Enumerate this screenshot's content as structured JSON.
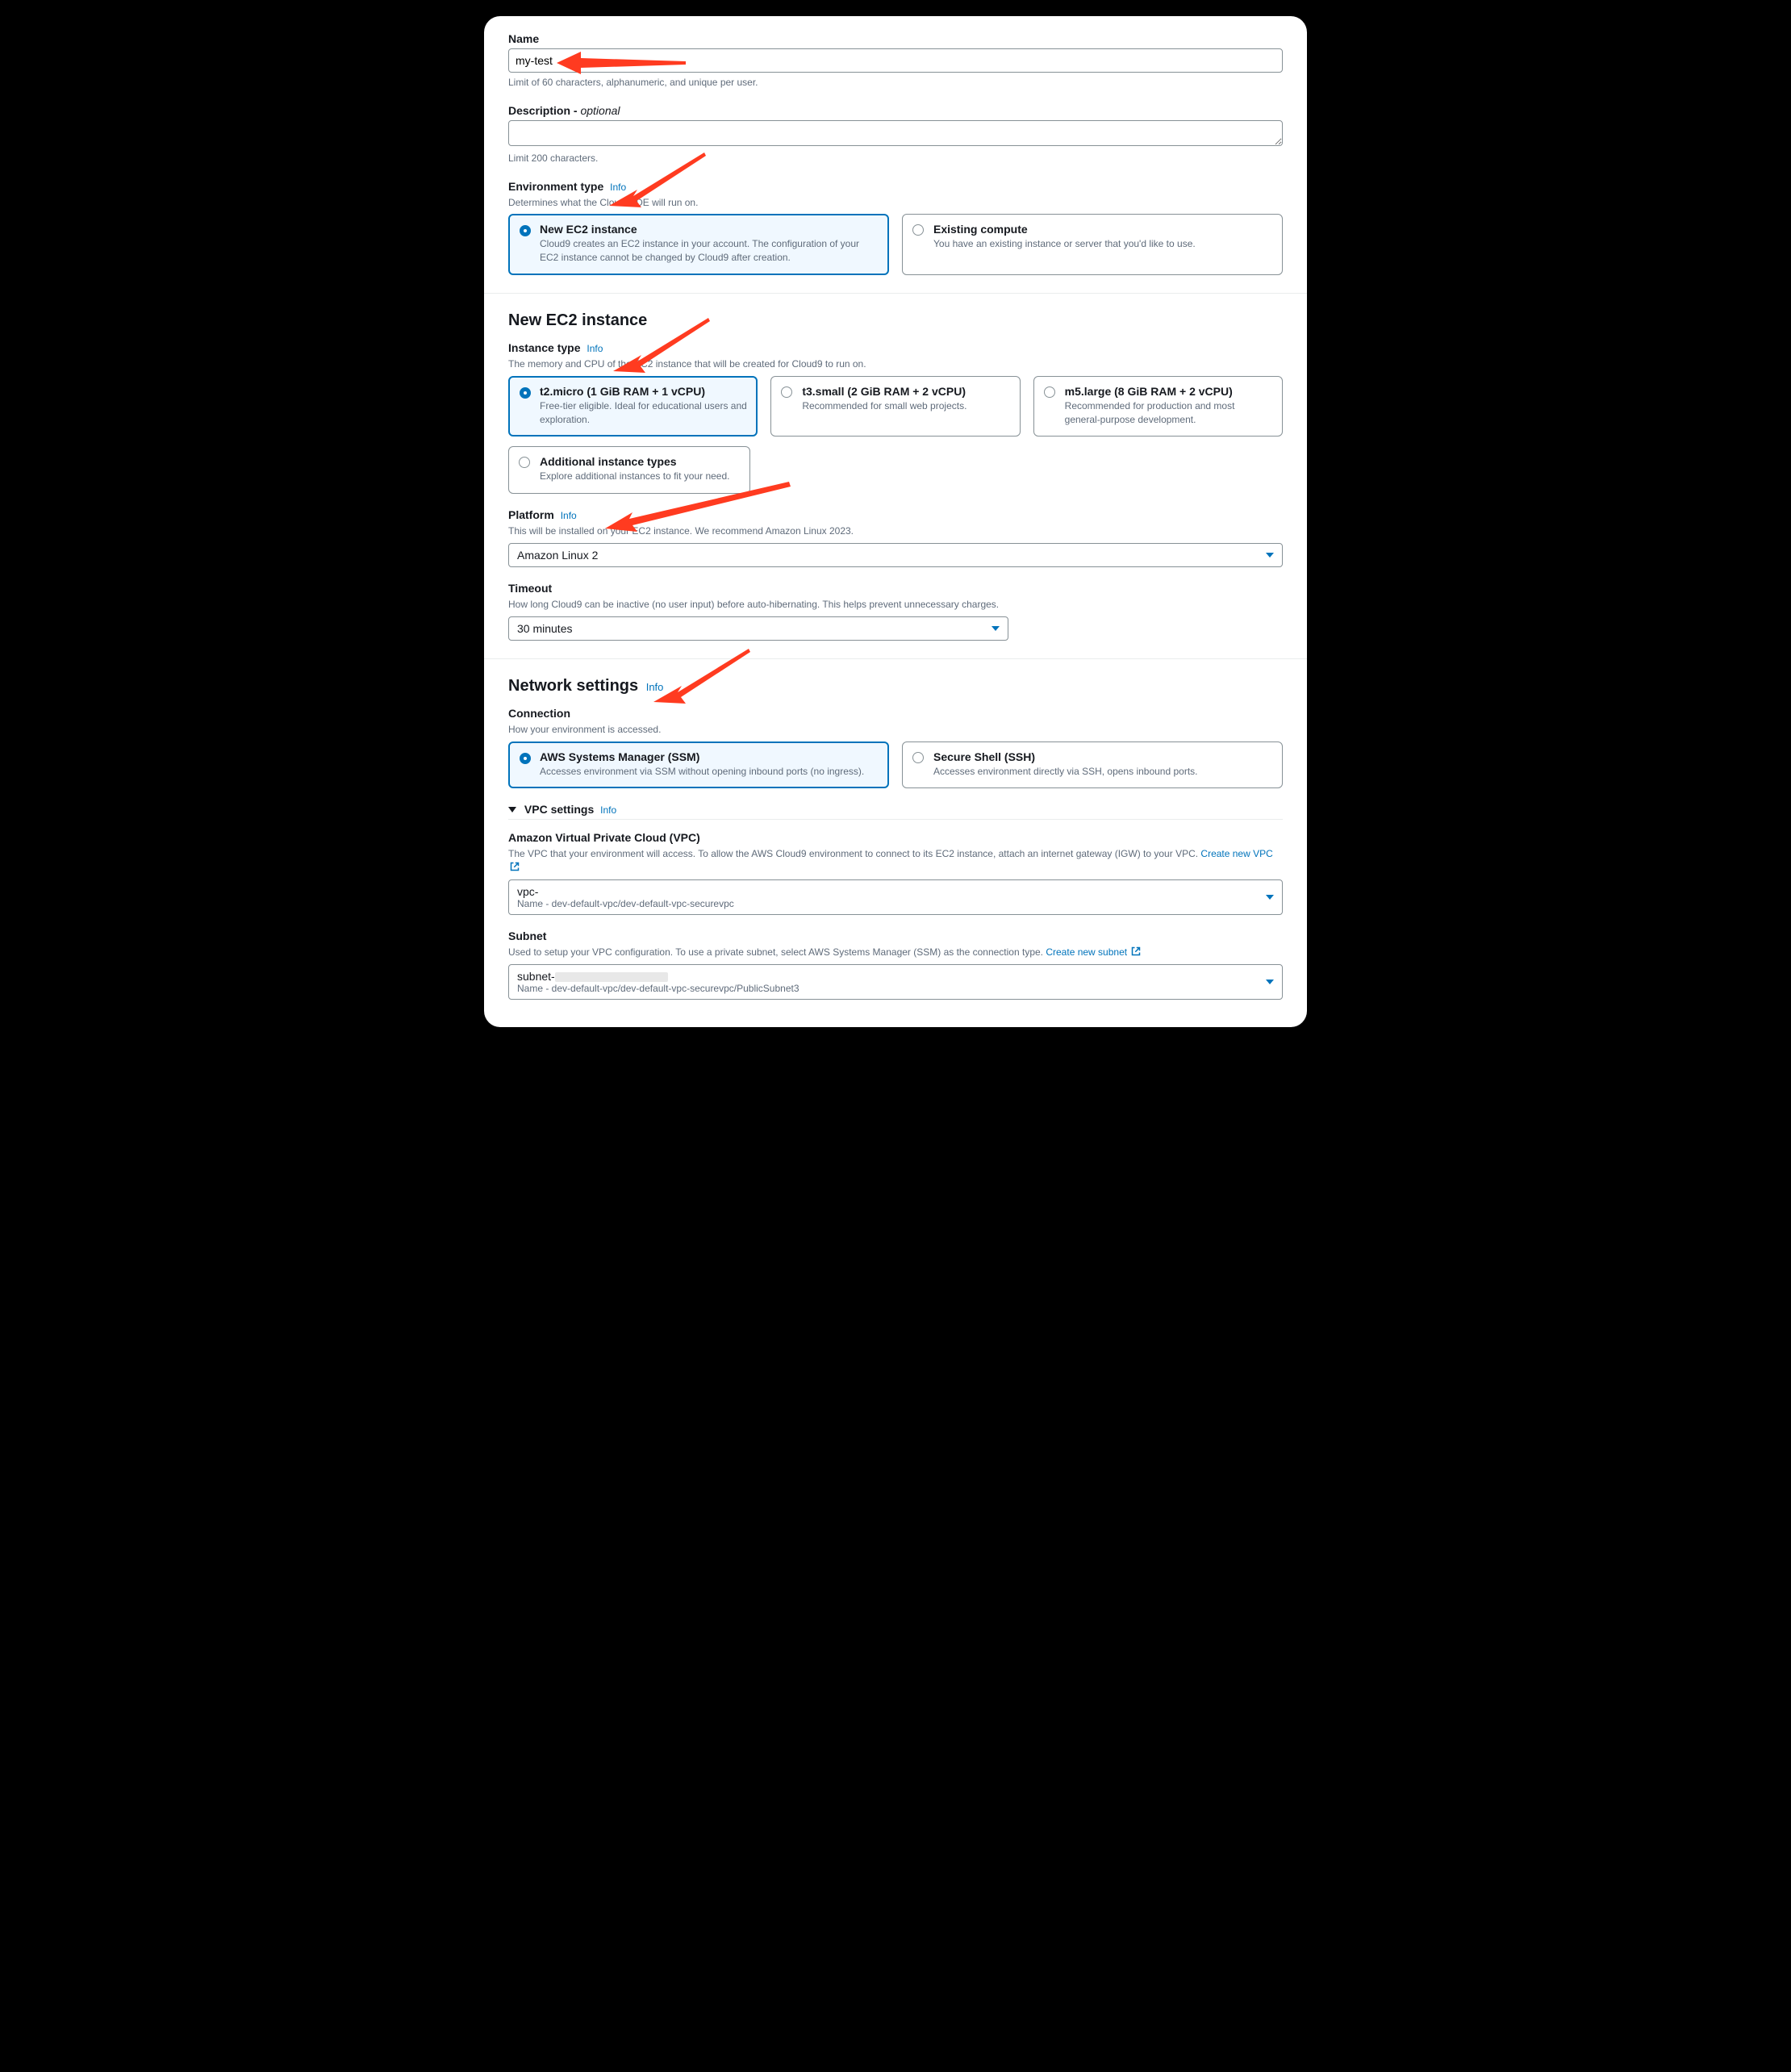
{
  "name": {
    "label": "Name",
    "value": "my-test",
    "help": "Limit of 60 characters, alphanumeric, and unique per user."
  },
  "description": {
    "label": "Description - ",
    "optional": "optional",
    "help": "Limit 200 characters."
  },
  "envType": {
    "label": "Environment type",
    "info": "Info",
    "sub": "Determines what the Cloud9 IDE will run on.",
    "options": [
      {
        "title": "New EC2 instance",
        "desc": "Cloud9 creates an EC2 instance in your account. The configuration of your EC2 instance cannot be changed by Cloud9 after creation.",
        "selected": true
      },
      {
        "title": "Existing compute",
        "desc": "You have an existing instance or server that you'd like to use.",
        "selected": false
      }
    ]
  },
  "ec2": {
    "title": "New EC2 instance",
    "instanceType": {
      "label": "Instance type",
      "info": "Info",
      "sub": "The memory and CPU of the EC2 instance that will be created for Cloud9 to run on.",
      "options": [
        {
          "title": "t2.micro (1 GiB RAM + 1 vCPU)",
          "desc": "Free-tier eligible. Ideal for educational users and exploration.",
          "selected": true
        },
        {
          "title": "t3.small (2 GiB RAM + 2 vCPU)",
          "desc": "Recommended for small web projects.",
          "selected": false
        },
        {
          "title": "m5.large (8 GiB RAM + 2 vCPU)",
          "desc": "Recommended for production and most general-purpose development.",
          "selected": false
        }
      ],
      "additional": {
        "title": "Additional instance types",
        "desc": "Explore additional instances to fit your need."
      }
    },
    "platform": {
      "label": "Platform",
      "info": "Info",
      "sub": "This will be installed on your EC2 instance. We recommend Amazon Linux 2023.",
      "value": "Amazon Linux 2"
    },
    "timeout": {
      "label": "Timeout",
      "sub": "How long Cloud9 can be inactive (no user input) before auto-hibernating. This helps prevent unnecessary charges.",
      "value": "30 minutes"
    }
  },
  "network": {
    "title": "Network settings",
    "info": "Info",
    "connection": {
      "label": "Connection",
      "sub": "How your environment is accessed.",
      "options": [
        {
          "title": "AWS Systems Manager (SSM)",
          "desc": "Accesses environment via SSM without opening inbound ports (no ingress).",
          "selected": true
        },
        {
          "title": "Secure Shell (SSH)",
          "desc": "Accesses environment directly via SSH, opens inbound ports.",
          "selected": false
        }
      ]
    },
    "vpcSettings": {
      "label": "VPC settings",
      "info": "Info"
    },
    "vpc": {
      "label": "Amazon Virtual Private Cloud (VPC)",
      "sub": "The VPC that your environment will access. To allow the AWS Cloud9 environment to connect to its EC2 instance, attach an internet gateway (IGW) to your VPC. ",
      "createLink": "Create new VPC",
      "value": "vpc-",
      "subvalue": "Name - dev-default-vpc/dev-default-vpc-securevpc"
    },
    "subnet": {
      "label": "Subnet",
      "sub": "Used to setup your VPC configuration. To use a private subnet, select AWS Systems Manager (SSM) as the connection type. ",
      "createLink": "Create new subnet",
      "value": "subnet-",
      "subvalue": "Name - dev-default-vpc/dev-default-vpc-securevpc/PublicSubnet3"
    }
  }
}
